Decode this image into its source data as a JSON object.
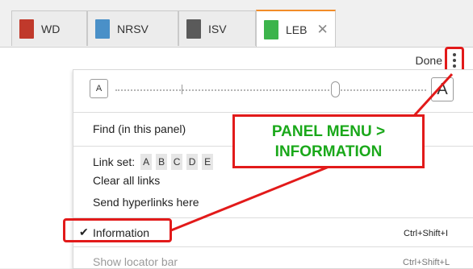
{
  "tabs": [
    {
      "label": "WD",
      "thumb_color": "#c0392b"
    },
    {
      "label": "NRSV",
      "thumb_color": "#4a90c8"
    },
    {
      "label": "ISV",
      "thumb_color": "#5a5a5a"
    },
    {
      "label": "LEB",
      "thumb_color": "#3cb44b",
      "active": true,
      "close": "✕"
    }
  ],
  "panel": {
    "done_label": "Done",
    "menu_icon": "vertical-ellipsis-icon"
  },
  "menu": {
    "font_small": "A",
    "font_large": "A",
    "find_label": "Find (in this panel)",
    "link_set_label": "Link set:",
    "link_set_options": [
      "A",
      "B",
      "C",
      "D",
      "E"
    ],
    "clear_links": "Clear all links",
    "send_hyperlinks": "Send hyperlinks here",
    "information": {
      "label": "Information",
      "checked": true,
      "check_glyph": "✔",
      "shortcut": "Ctrl+Shift+I"
    },
    "locator": {
      "label": "Show locator bar",
      "shortcut": "Ctrl+Shift+L"
    }
  },
  "annotation": {
    "line1": "PANEL MENU >",
    "line2": "INFORMATION",
    "color": "#e21a1a",
    "text_color": "#1aa81a"
  }
}
